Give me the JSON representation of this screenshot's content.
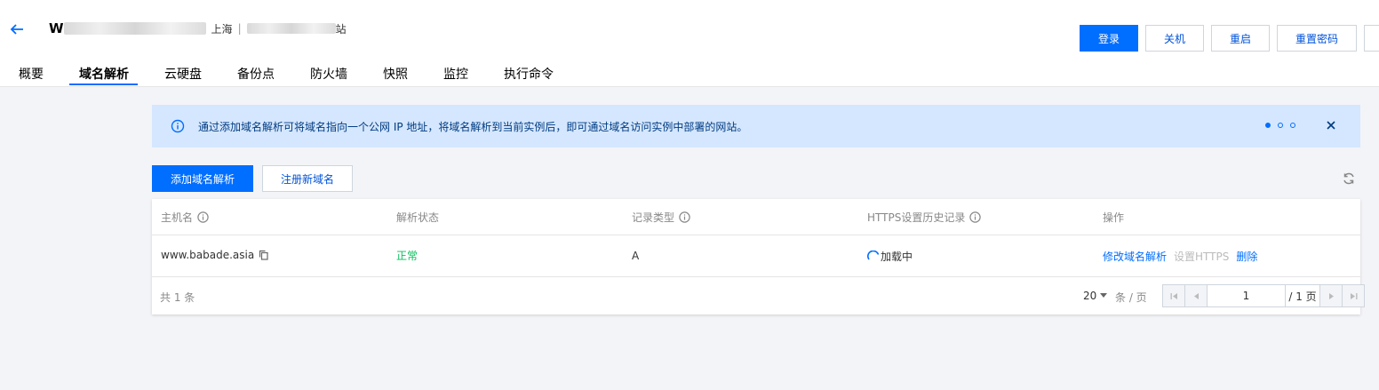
{
  "header": {
    "title_prefix": "W",
    "region": "上海",
    "separator": "|",
    "title_suffix": "站",
    "actions": [
      "登录",
      "关机",
      "重启",
      "重置密码"
    ]
  },
  "tabs": [
    "概要",
    "域名解析",
    "云硬盘",
    "备份点",
    "防火墙",
    "快照",
    "监控",
    "执行命令"
  ],
  "active_tab": "域名解析",
  "banner": {
    "text": "通过添加域名解析可将域名指向一个公网 IP 地址，将域名解析到当前实例后，即可通过域名访问实例中部署的网站。",
    "carousel_index": 1,
    "carousel_total": 3
  },
  "toolbar": {
    "add_label": "添加域名解析",
    "register_label": "注册新域名"
  },
  "table": {
    "columns": [
      "主机名",
      "解析状态",
      "记录类型",
      "HTTPS设置历史记录",
      "操作"
    ],
    "rows": [
      {
        "host": "www.babade.asia",
        "status": "正常",
        "type": "A",
        "https": "加载中",
        "actions": [
          "修改域名解析",
          "设置HTTPS",
          "删除"
        ]
      }
    ],
    "total": "共 1 条",
    "page_size": "20",
    "per_page_label": "条 / 页",
    "current_page": "1",
    "page_total": "/ 1 页"
  },
  "colors": {
    "primary": "#006eff",
    "link": "#0052d9",
    "success": "#0abf5b",
    "banner_bg": "#d5e7ff"
  }
}
